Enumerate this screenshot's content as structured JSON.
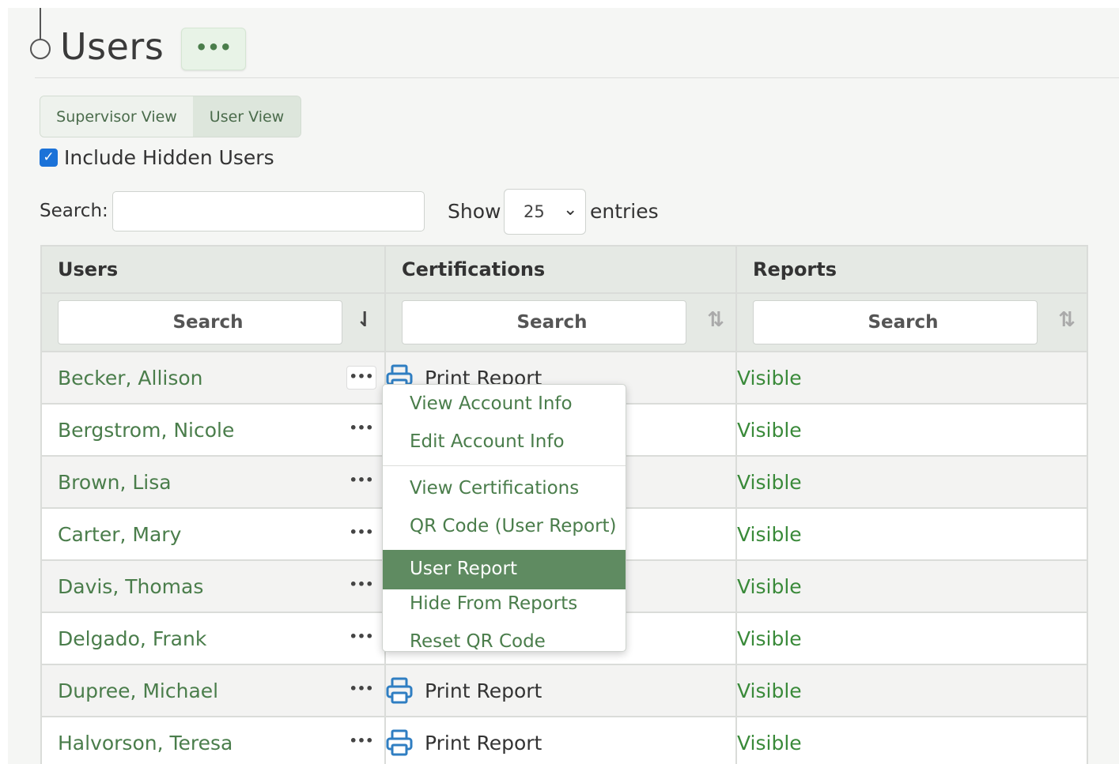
{
  "page": {
    "title": "Users",
    "more_button_label": "•••"
  },
  "view_toggle": {
    "supervisor": "Supervisor View",
    "user": "User View"
  },
  "filters": {
    "include_hidden_label": "Include Hidden Users",
    "include_hidden_checked": true,
    "search_label": "Search:",
    "search_value": "",
    "show_label": "Show",
    "entries_value": "25",
    "entries_label": "entries"
  },
  "table": {
    "columns": [
      "Users",
      "Certifications",
      "Reports"
    ],
    "column_search_placeholder": "Search",
    "rows": [
      {
        "name": "Becker, Allison",
        "cert": "Print Report",
        "report": "Visible"
      },
      {
        "name": "Bergstrom, Nicole",
        "cert": "",
        "report": "Visible"
      },
      {
        "name": "Brown, Lisa",
        "cert": "",
        "report": "Visible"
      },
      {
        "name": "Carter, Mary",
        "cert": "",
        "report": "Visible"
      },
      {
        "name": "Davis, Thomas",
        "cert": "",
        "report": "Visible"
      },
      {
        "name": "Delgado, Frank",
        "cert": "",
        "report": "Visible"
      },
      {
        "name": "Dupree, Michael",
        "cert": "Print Report",
        "report": "Visible"
      },
      {
        "name": "Halvorson, Teresa",
        "cert": "Print Report",
        "report": "Visible"
      }
    ],
    "row_more_label": "•••"
  },
  "dropdown": {
    "items": [
      "View Account Info",
      "Edit Account Info",
      "View Certifications",
      "QR Code (User Report)",
      "User Report",
      "Hide From Reports",
      "Reset QR Code"
    ],
    "active_index": 4
  },
  "colors": {
    "accent_green": "#5f8b61",
    "link_green": "#4a7d4b",
    "visible_green": "#3a8a3a",
    "printer_blue": "#2f7ec2",
    "checkbox_blue": "#1b72d8"
  }
}
